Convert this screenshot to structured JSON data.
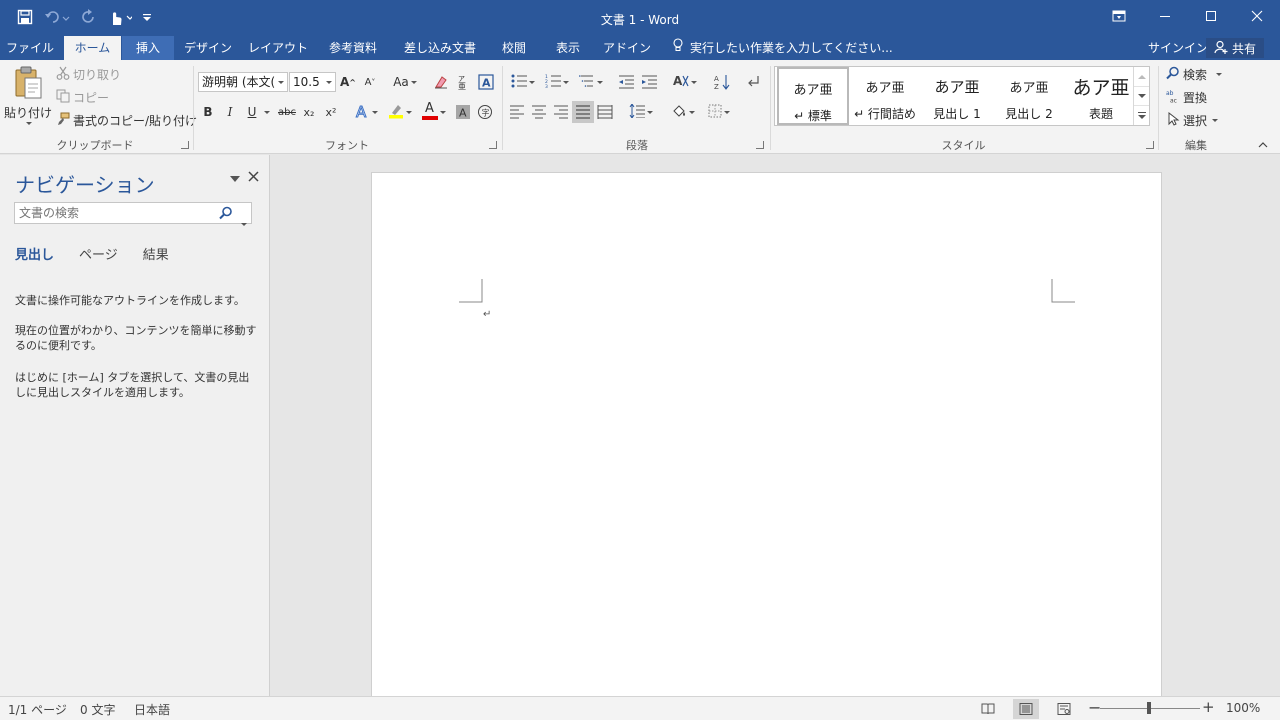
{
  "window": {
    "title": "文書 1 - Word"
  },
  "tabs": [
    "ファイル",
    "ホーム",
    "挿入",
    "デザイン",
    "レイアウト",
    "参考資料",
    "差し込み文書",
    "校閲",
    "表示",
    "アドイン"
  ],
  "tell_me": "実行したい作業を入力してください...",
  "account": {
    "signin": "サインイン",
    "share": "共有"
  },
  "clipboard": {
    "paste": "貼り付け",
    "cut": "切り取り",
    "copy": "コピー",
    "format_painter": "書式のコピー/貼り付け",
    "label": "クリップボード"
  },
  "font": {
    "name": "游明朝 (本文(",
    "size": "10.5",
    "label": "フォント",
    "grow": "A",
    "shrink": "A",
    "case": "Aa",
    "bold": "B",
    "italic": "I",
    "underline": "U",
    "strike": "abc",
    "subscript": "x₂",
    "superscript": "x²",
    "font_color_letter": "A",
    "highlight_color": "#ffff00",
    "font_color": "#e00000"
  },
  "paragraph": {
    "label": "段落"
  },
  "styles": {
    "label": "スタイル",
    "items": [
      {
        "sample": "あア亜",
        "name": "↵ 標準"
      },
      {
        "sample": "あア亜",
        "name": "↵ 行間詰め"
      },
      {
        "sample": "あア亜",
        "name": "見出し 1"
      },
      {
        "sample": "あア亜",
        "name": "見出し 2"
      },
      {
        "sample": "あア亜",
        "name": "表題"
      }
    ]
  },
  "editing": {
    "find": "検索",
    "replace": "置換",
    "select": "選択",
    "label": "編集"
  },
  "nav": {
    "title": "ナビゲーション",
    "search_placeholder": "文書の検索",
    "tabs": [
      "見出し",
      "ページ",
      "結果"
    ],
    "msg1": "文書に操作可能なアウトラインを作成します。",
    "msg2": "現在の位置がわかり、コンテンツを簡単に移動するのに便利です。",
    "msg3": "はじめに [ホーム] タブを選択して、文書の見出しに見出しスタイルを適用します。"
  },
  "document": {
    "pilcrow": "↵"
  },
  "status": {
    "page": "1/1 ページ",
    "words": "0 文字",
    "language": "日本語",
    "zoom": "100%"
  },
  "colors": {
    "accent": "#2b579a"
  }
}
